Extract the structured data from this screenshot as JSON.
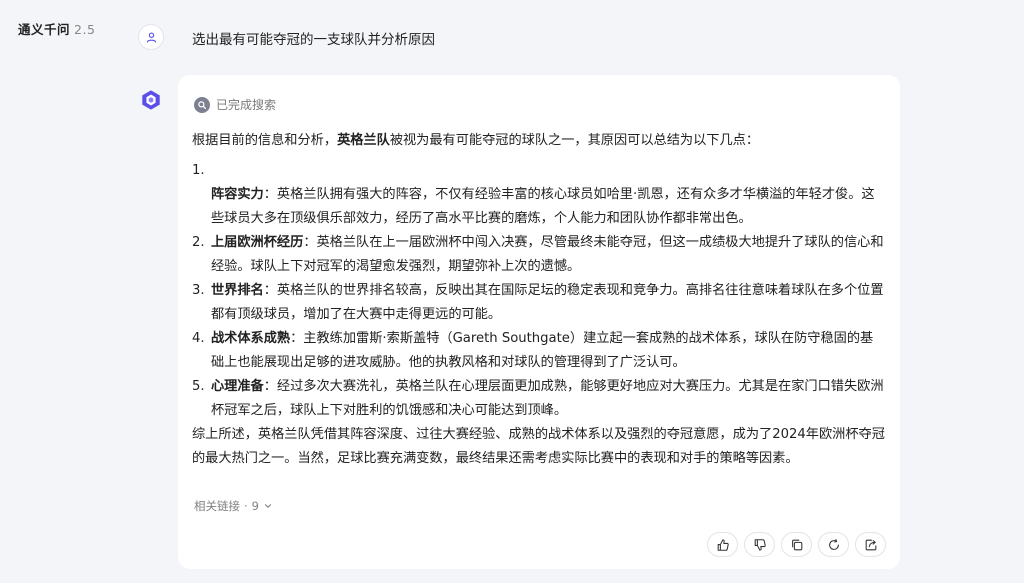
{
  "app": {
    "title": "通义千问",
    "version": "2.5"
  },
  "user_message": "选出最有可能夺冠的一支球队并分析原因",
  "response": {
    "search_status": "已完成搜索",
    "intro_prefix": "根据目前的信息和分析，",
    "intro_team": "英格兰队",
    "intro_suffix": "被视为最有可能夺冠的球队之一，其原因可以总结为以下几点：",
    "points": [
      {
        "num": "1.",
        "title": "阵容实力",
        "text": "：英格兰队拥有强大的阵容，不仅有经验丰富的核心球员如哈里·凯恩，还有众多才华横溢的年轻才俊。这些球员大多在顶级俱乐部效力，经历了高水平比赛的磨炼，个人能力和团队协作都非常出色。"
      },
      {
        "num": "2.",
        "title": "上届欧洲杯经历",
        "text": "：英格兰队在上一届欧洲杯中闯入决赛，尽管最终未能夺冠，但这一成绩极大地提升了球队的信心和经验。球队上下对冠军的渴望愈发强烈，期望弥补上次的遗憾。"
      },
      {
        "num": "3.",
        "title": "世界排名",
        "text": "：英格兰队的世界排名较高，反映出其在国际足坛的稳定表现和竞争力。高排名往往意味着球队在多个位置都有顶级球员，增加了在大赛中走得更远的可能。"
      },
      {
        "num": "4.",
        "title": "战术体系成熟",
        "text": "：主教练加雷斯·索斯盖特（Gareth Southgate）建立起一套成熟的战术体系，球队在防守稳固的基础上也能展现出足够的进攻威胁。他的执教风格和对球队的管理得到了广泛认可。"
      },
      {
        "num": "5.",
        "title": "心理准备",
        "text": "：经过多次大赛洗礼，英格兰队在心理层面更加成熟，能够更好地应对大赛压力。尤其是在家门口错失欧洲杯冠军之后，球队上下对胜利的饥饿感和决心可能达到顶峰。"
      }
    ],
    "summary": "综上所述，英格兰队凭借其阵容深度、过往大赛经验、成熟的战术体系以及强烈的夺冠意愿，成为了2024年欧洲杯夺冠的最大热门之一。当然，足球比赛充满变数，最终结果还需考虑实际比赛中的表现和对手的策略等因素。",
    "related_label": "相关链接",
    "related_count": "9"
  },
  "actions": [
    "thumbs-up-icon",
    "thumbs-down-icon",
    "copy-icon",
    "regenerate-icon",
    "share-icon"
  ],
  "colors": {
    "background": "#f4f5f9",
    "card": "#ffffff",
    "muted_text": "#7a7a7a",
    "bot_avatar": "#5b4ee8"
  }
}
